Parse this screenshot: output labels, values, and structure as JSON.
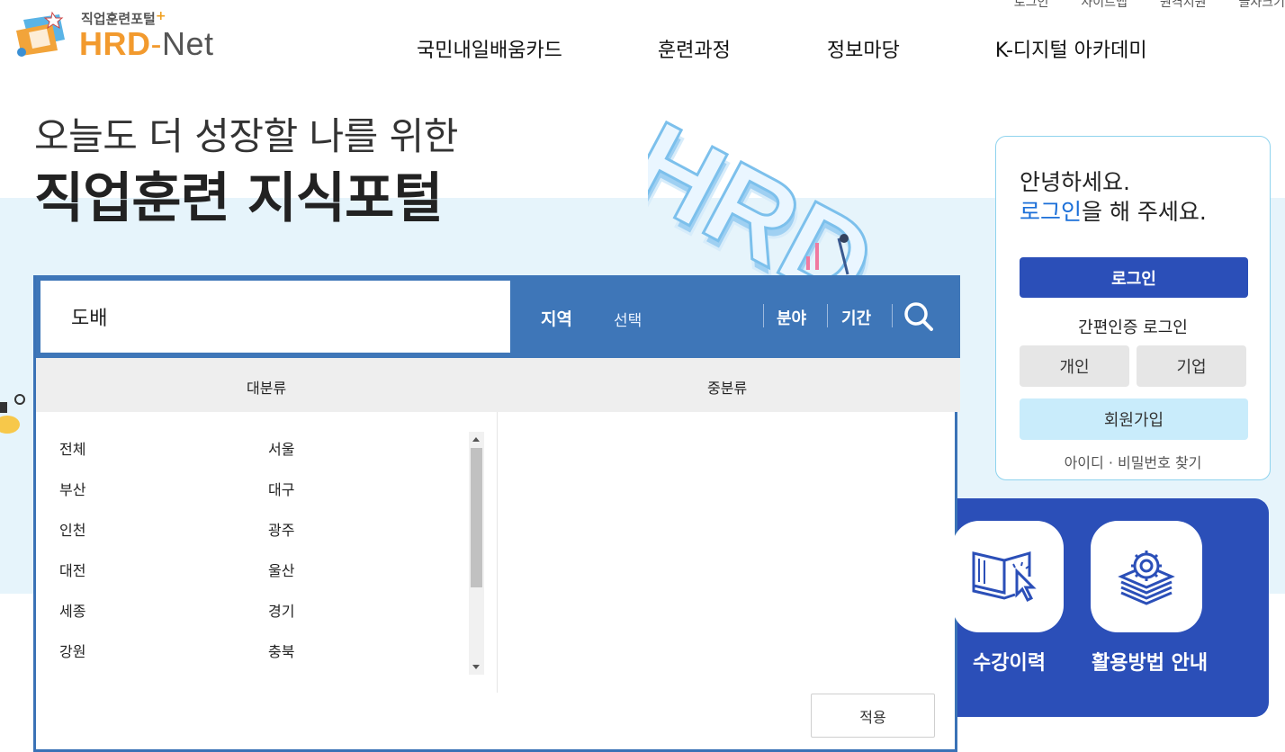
{
  "header": {
    "logo_subtitle": "직업훈련포털",
    "logo_plus": "+",
    "logo_hrd": "HRD",
    "logo_dash": "-",
    "logo_net": "Net",
    "utility_links": [
      "로그인",
      "사이트맵",
      "원격지원",
      "글자크기"
    ],
    "nav": [
      "국민내일배움카드",
      "훈련과정",
      "정보마당",
      "K-디지털 아카데미"
    ]
  },
  "hero": {
    "line1": "오늘도 더 성장할 나를 위한",
    "line2": "직업훈련 지식포털",
    "deco_text": "HRD"
  },
  "search": {
    "keyword": "도배",
    "region_label": "지역",
    "region_value": "선택",
    "field_label": "분야",
    "period_label": "기간",
    "col_major": "대분류",
    "col_minor": "중분류",
    "regions_left": [
      "전체",
      "부산",
      "인천",
      "대전",
      "세종",
      "강원"
    ],
    "regions_right": [
      "서울",
      "대구",
      "광주",
      "울산",
      "경기",
      "충북"
    ],
    "apply_label": "적용"
  },
  "login": {
    "greeting_1": "안녕하세요.",
    "greeting_link": "로그인",
    "greeting_2": "을 해 주세요.",
    "login_button": "로그인",
    "easy_login_title": "간편인증 로그인",
    "personal_button": "개인",
    "company_button": "기업",
    "join_button": "회원가입",
    "find_link": "아이디 · 비밀번호 찾기"
  },
  "services": {
    "history_label": "수강이력",
    "guide_label": "활용방법 안내"
  },
  "colors": {
    "primary_blue": "#2b4fb8",
    "search_bar_blue": "#3e76b8",
    "link_blue": "#1b6fd8",
    "light_sky": "#e6f4fb",
    "join_bg": "#c9ecfb",
    "logo_orange": "#f29a2e"
  }
}
